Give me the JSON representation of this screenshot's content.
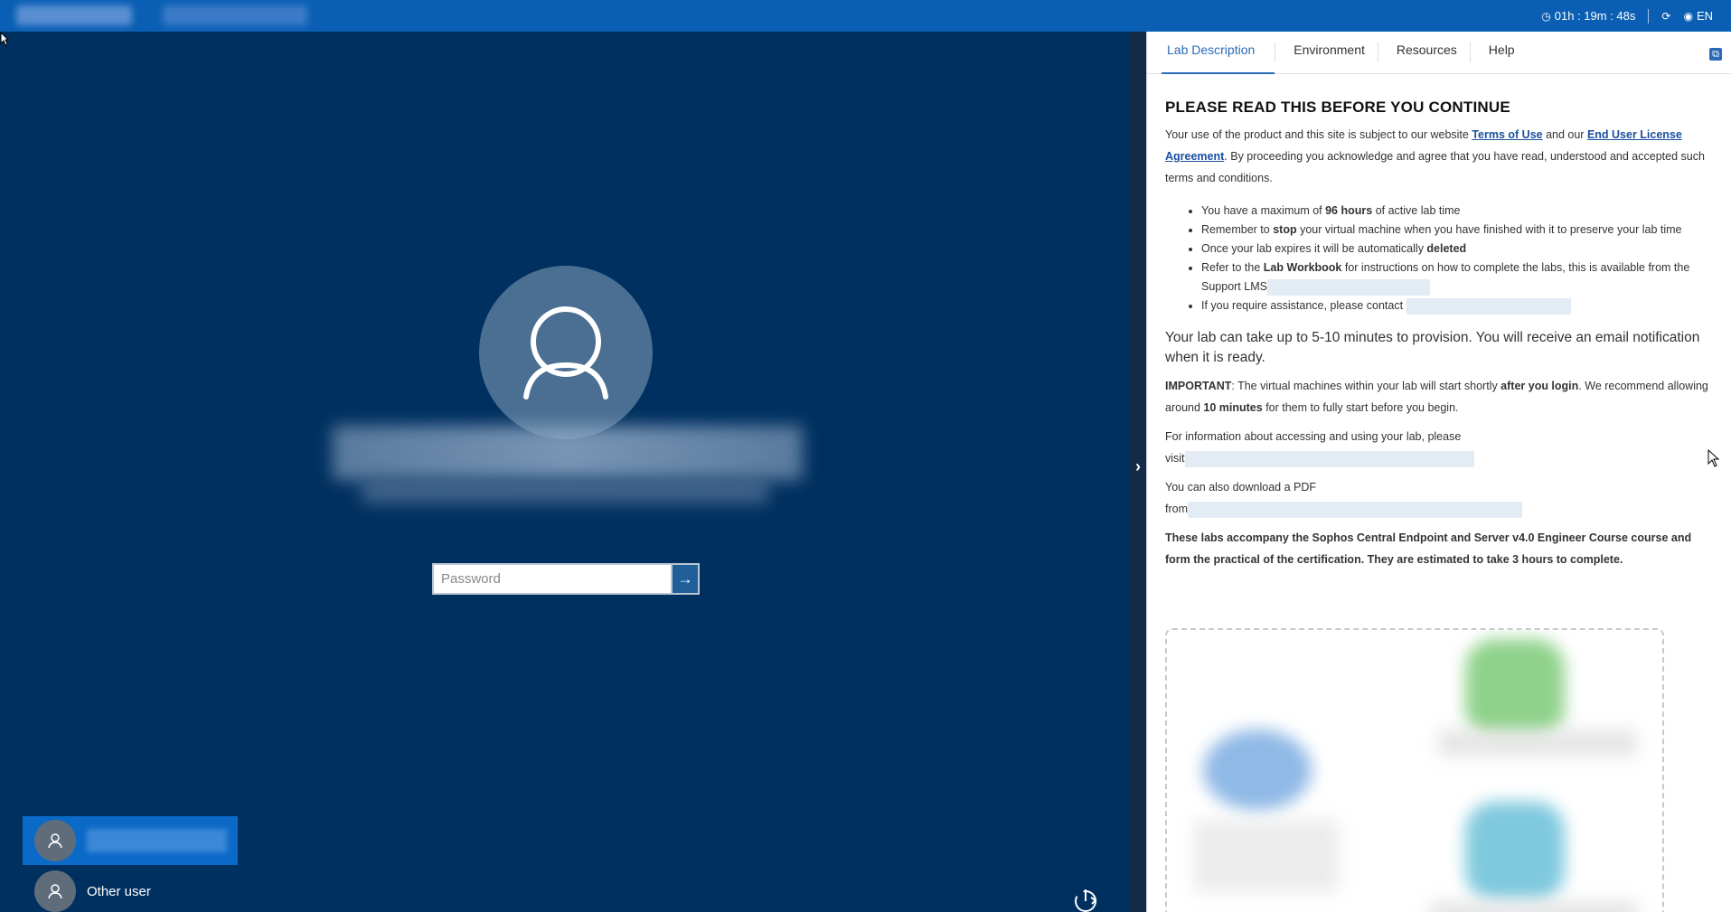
{
  "topbar": {
    "timer": "01h : 19m : 48s",
    "language": "EN",
    "icons": [
      "clock-icon",
      "refresh-icon",
      "globe-icon"
    ]
  },
  "login": {
    "password_placeholder": "Password",
    "submit_glyph": "→",
    "users": [
      {
        "label": ""
      },
      {
        "label": "Other user"
      }
    ]
  },
  "panel": {
    "tabs": [
      {
        "label": "Lab Description"
      },
      {
        "label": "Environment"
      },
      {
        "label": "Resources"
      },
      {
        "label": "Help"
      }
    ],
    "heading": "PLEASE READ THIS BEFORE YOU CONTINUE",
    "intro": {
      "before": "Your use of the product and this site is subject to our website ",
      "link1": "Terms of Use",
      "mid": " and our ",
      "link2": "End User License Agreement",
      "after": ". By proceeding you acknowledge and agree that you have read, understood and accepted such terms and conditions."
    },
    "bullets": [
      {
        "a": "You have a maximum of ",
        "b": "96 hours",
        "c": " of active lab time"
      },
      {
        "a": "Remember to ",
        "b": "stop",
        "c": " your virtual machine when you have finished with it to preserve your lab time"
      },
      {
        "a": "Once your lab expires it will be automatically ",
        "b": "deleted",
        "c": ""
      },
      {
        "a": "Refer to the ",
        "b": "Lab Workbook",
        "c": " for instructions on how to complete the labs, this is available from the Support LMS"
      },
      {
        "a": "If you require assistance, please contact ",
        "b": "",
        "c": ""
      }
    ],
    "provision_text": "Your lab can take up to 5-10 minutes to provision. You will receive an email notification when it is ready.",
    "important": {
      "label": "IMPORTANT",
      "t1": ": The virtual machines within your lab will start shortly ",
      "b1": "after you login",
      "t2": ". We recommend allowing around ",
      "b2": "10 minutes",
      "t3": " for them to fully start before you begin."
    },
    "info_text": "For information about accessing and using your lab, please",
    "info_visit": "visit",
    "pdf_text": "You can also download a PDF",
    "pdf_from": "from",
    "course_text": "These labs accompany the Sophos Central Endpoint and Server v4.0 Engineer Course course and form the practical of the certification. They are estimated to take 3 hours to complete."
  },
  "colors": {
    "topbar": "#0a5fb4",
    "desktop": "#00305f",
    "accent": "#2a6ab7",
    "selected_user": "#0b69c7"
  }
}
